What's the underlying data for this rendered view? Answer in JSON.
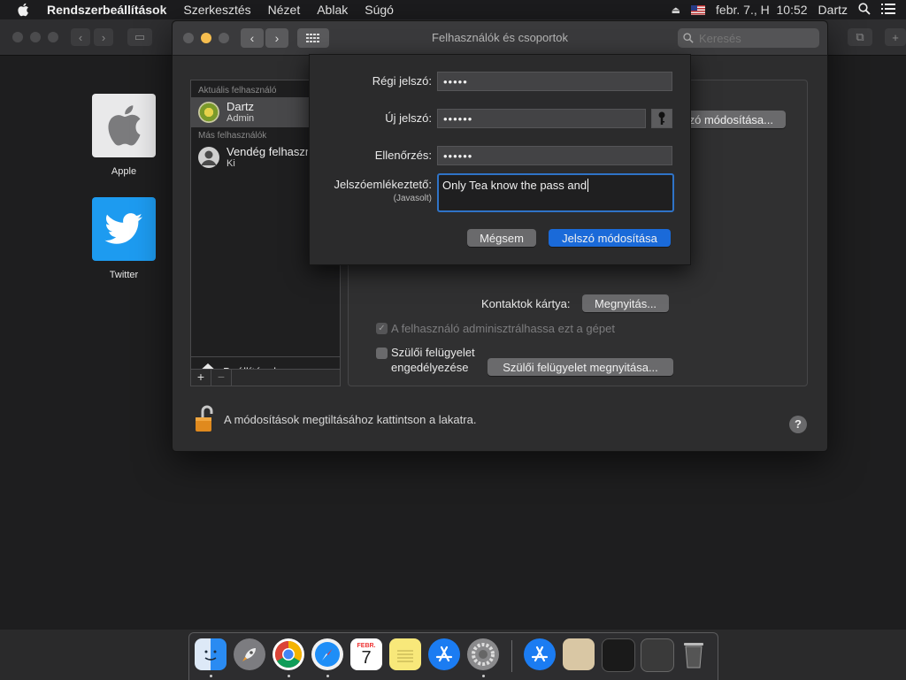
{
  "menubar": {
    "app_name": "Rendszerbeállítások",
    "items": [
      "Szerkesztés",
      "Nézet",
      "Ablak",
      "Súgó"
    ],
    "datetime": "febr. 7., H  10:52",
    "user": "Dartz"
  },
  "desktop": {
    "icons": [
      {
        "label": "Apple",
        "icon": "apple-logo-icon"
      },
      {
        "label": "Twitter",
        "icon": "twitter-bird-icon"
      }
    ]
  },
  "window": {
    "title": "Felhasználók és csoportok",
    "search_placeholder": "Keresés"
  },
  "users": {
    "current_header": "Aktuális felhasználó",
    "current": {
      "name": "Dartz",
      "role": "Admin"
    },
    "others_header": "Más felhasználók",
    "others": [
      {
        "name": "Vendég felhasználó",
        "status": "Ki"
      }
    ],
    "prefs_label": "Beállítások",
    "add": "+",
    "remove": "−"
  },
  "panel": {
    "change_password_button": "Jelszó módosítása...",
    "contacts_label": "Kontaktok kártya:",
    "contacts_button": "Megnyitás...",
    "admin_checkbox_label": "A felhasználó adminisztrálhassa ezt a gépet",
    "admin_checked": true,
    "parental_checkbox_label_1": "Szülői felügyelet",
    "parental_checkbox_label_2": "engedélyezése",
    "parental_checked": false,
    "parental_button": "Szülői felügyelet megnyitása..."
  },
  "sheet": {
    "old_password_label": "Régi jelszó:",
    "old_password_value": "•••••",
    "new_password_label": "Új jelszó:",
    "new_password_value": "••••••",
    "verify_label": "Ellenőrzés:",
    "verify_value": "••••••",
    "hint_label": "Jelszóemlékeztető:",
    "hint_sublabel": "(Javasolt)",
    "hint_value": "Only Tea know the pass and",
    "cancel_button": "Mégsem",
    "confirm_button": "Jelszó módosítása"
  },
  "lockbar": {
    "text": "A módosítások megtiltásához kattintson a lakatra.",
    "help": "?"
  },
  "calendar": {
    "month": "FEBR.",
    "day": "7"
  },
  "colors": {
    "accent": "#1a6ad9",
    "twitter": "#1d9bf0"
  }
}
